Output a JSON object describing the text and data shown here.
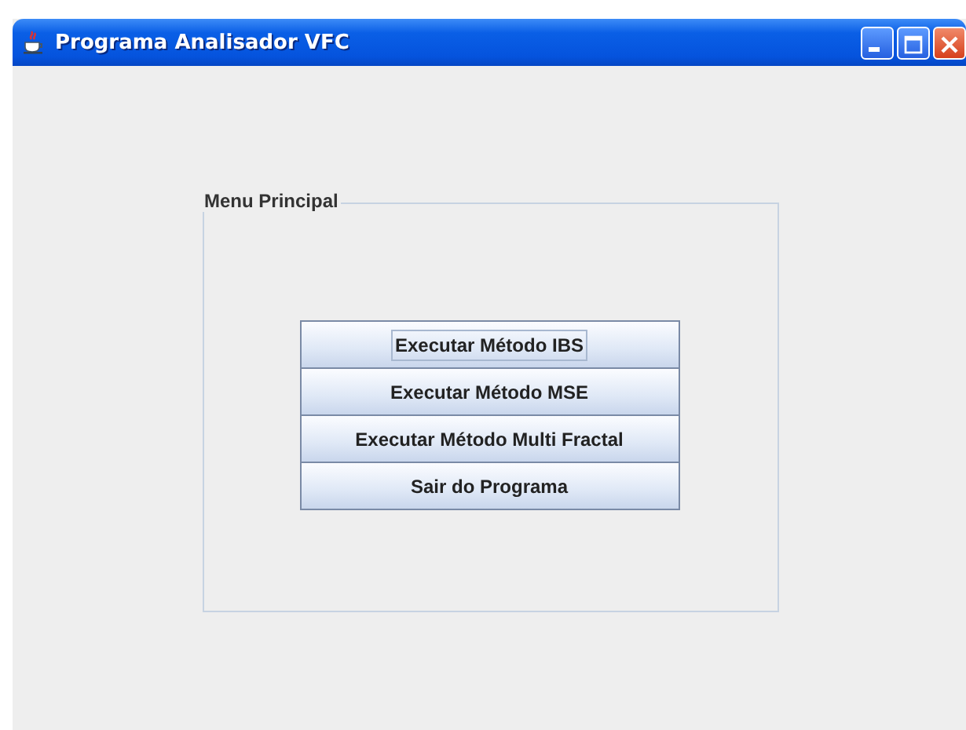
{
  "window": {
    "title": "Programa Analisador VFC"
  },
  "panel": {
    "title": "Menu Principal"
  },
  "buttons": [
    {
      "label": "Executar Método IBS",
      "focused": true
    },
    {
      "label": "Executar Método MSE",
      "focused": false
    },
    {
      "label": "Executar Método Multi Fractal",
      "focused": false
    },
    {
      "label": "Sair do Programa",
      "focused": false
    }
  ]
}
